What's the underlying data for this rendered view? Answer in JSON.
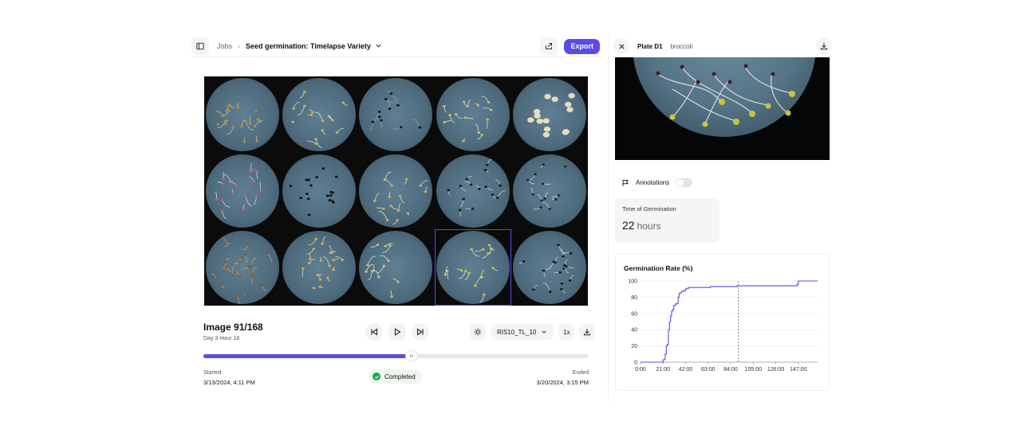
{
  "header": {
    "breadcrumb_jobs": "Jobs",
    "breadcrumb_sep": "›",
    "job_title": "Seed germination: Timelapse Variety",
    "export_label": "Export"
  },
  "viewer": {
    "image_title": "Image 91/168",
    "image_sub": "Day 3 Hour 18",
    "camera_select": "RIS10_TL_10",
    "speed": "1x",
    "progress": 0.54,
    "scrub_glyph": "‹›",
    "started_label": "Started",
    "started_value": "3/13/2024, 4:11 PM",
    "ended_label": "Ended",
    "ended_value": "3/20/2024, 3:15 PM",
    "status": "Completed",
    "selected_cell": 13
  },
  "panel": {
    "plate_name": "Plate D1",
    "plate_variety": "broccoli",
    "annotations_label": "Annotations",
    "annotations_on": false,
    "tog_label": "Time of Germination",
    "tog_value": "22",
    "tog_unit": "hours"
  },
  "colors": {
    "accent": "#5b4be8",
    "status_green": "#22a052"
  },
  "chart_data": {
    "type": "line",
    "title": "Germination Rate (%)",
    "xlabel": "",
    "ylabel": "",
    "x_tick_labels": [
      "0:00",
      "21:00",
      "42:00",
      "63:00",
      "84:00",
      "105:00",
      "126:00",
      "147:00"
    ],
    "x_ticks": [
      0,
      21,
      42,
      63,
      84,
      105,
      126,
      147
    ],
    "y_ticks": [
      0,
      20,
      40,
      60,
      80,
      100
    ],
    "xlim": [
      0,
      165
    ],
    "ylim": [
      0,
      100
    ],
    "grid": true,
    "marker_x": 91,
    "series": [
      {
        "x": [
          0,
          20,
          21,
          23,
          24,
          25,
          26,
          27,
          28,
          29,
          30,
          31,
          33,
          35,
          36,
          38,
          40,
          42,
          43,
          45,
          47,
          60,
          65,
          75,
          90,
          110,
          140,
          146,
          147,
          165
        ],
        "values": [
          0,
          0,
          3,
          10,
          20,
          22,
          40,
          50,
          57,
          63,
          65,
          70,
          72,
          80,
          85,
          87,
          88,
          90,
          91,
          92,
          92,
          92,
          93,
          93,
          94,
          94,
          94,
          96,
          100,
          100
        ]
      }
    ]
  }
}
